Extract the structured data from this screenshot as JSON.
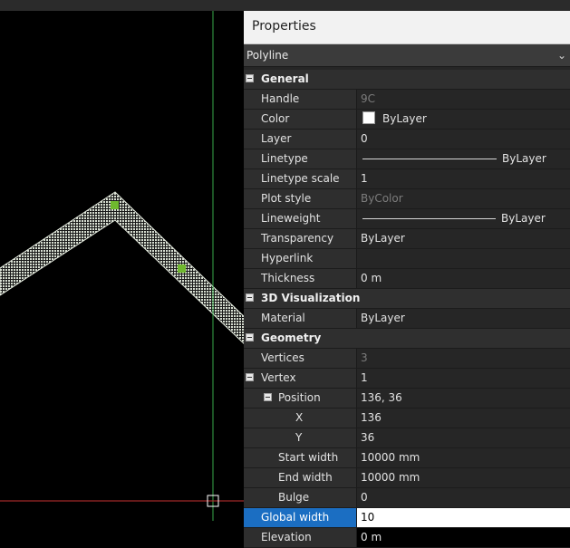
{
  "panel": {
    "title": "Properties",
    "selected_type": "Polyline"
  },
  "sections": {
    "general": "General",
    "viz": "3D Visualization",
    "geometry": "Geometry"
  },
  "rows": {
    "handle": {
      "label": "Handle",
      "value": "9C"
    },
    "color": {
      "label": "Color",
      "value": "ByLayer"
    },
    "layer": {
      "label": "Layer",
      "value": "0"
    },
    "linetype": {
      "label": "Linetype",
      "value": "ByLayer"
    },
    "linetype_scale": {
      "label": "Linetype scale",
      "value": "1"
    },
    "plot_style": {
      "label": "Plot style",
      "value": "ByColor"
    },
    "lineweight": {
      "label": "Lineweight",
      "value": "ByLayer"
    },
    "transparency": {
      "label": "Transparency",
      "value": "ByLayer"
    },
    "hyperlink": {
      "label": "Hyperlink",
      "value": ""
    },
    "thickness": {
      "label": "Thickness",
      "value": "0 m"
    },
    "material": {
      "label": "Material",
      "value": "ByLayer"
    },
    "vertices": {
      "label": "Vertices",
      "value": "3"
    },
    "vertex": {
      "label": "Vertex",
      "value": "1"
    },
    "position": {
      "label": "Position",
      "value": "136, 36"
    },
    "x": {
      "label": "X",
      "value": "136"
    },
    "y": {
      "label": "Y",
      "value": "36"
    },
    "start_width": {
      "label": "Start width",
      "value": "10000 mm"
    },
    "end_width": {
      "label": "End width",
      "value": "10000 mm"
    },
    "bulge": {
      "label": "Bulge",
      "value": "0"
    },
    "global_width": {
      "label": "Global width",
      "value": "10"
    },
    "elevation": {
      "label": "Elevation",
      "value": "0 m"
    }
  },
  "colors": {
    "polyline_fill": "#cfd8c8",
    "grip": "#6fb82e",
    "crosshair_v": "#37a84a",
    "crosshair_h": "#c83232",
    "selection": "#1b6ec2"
  }
}
